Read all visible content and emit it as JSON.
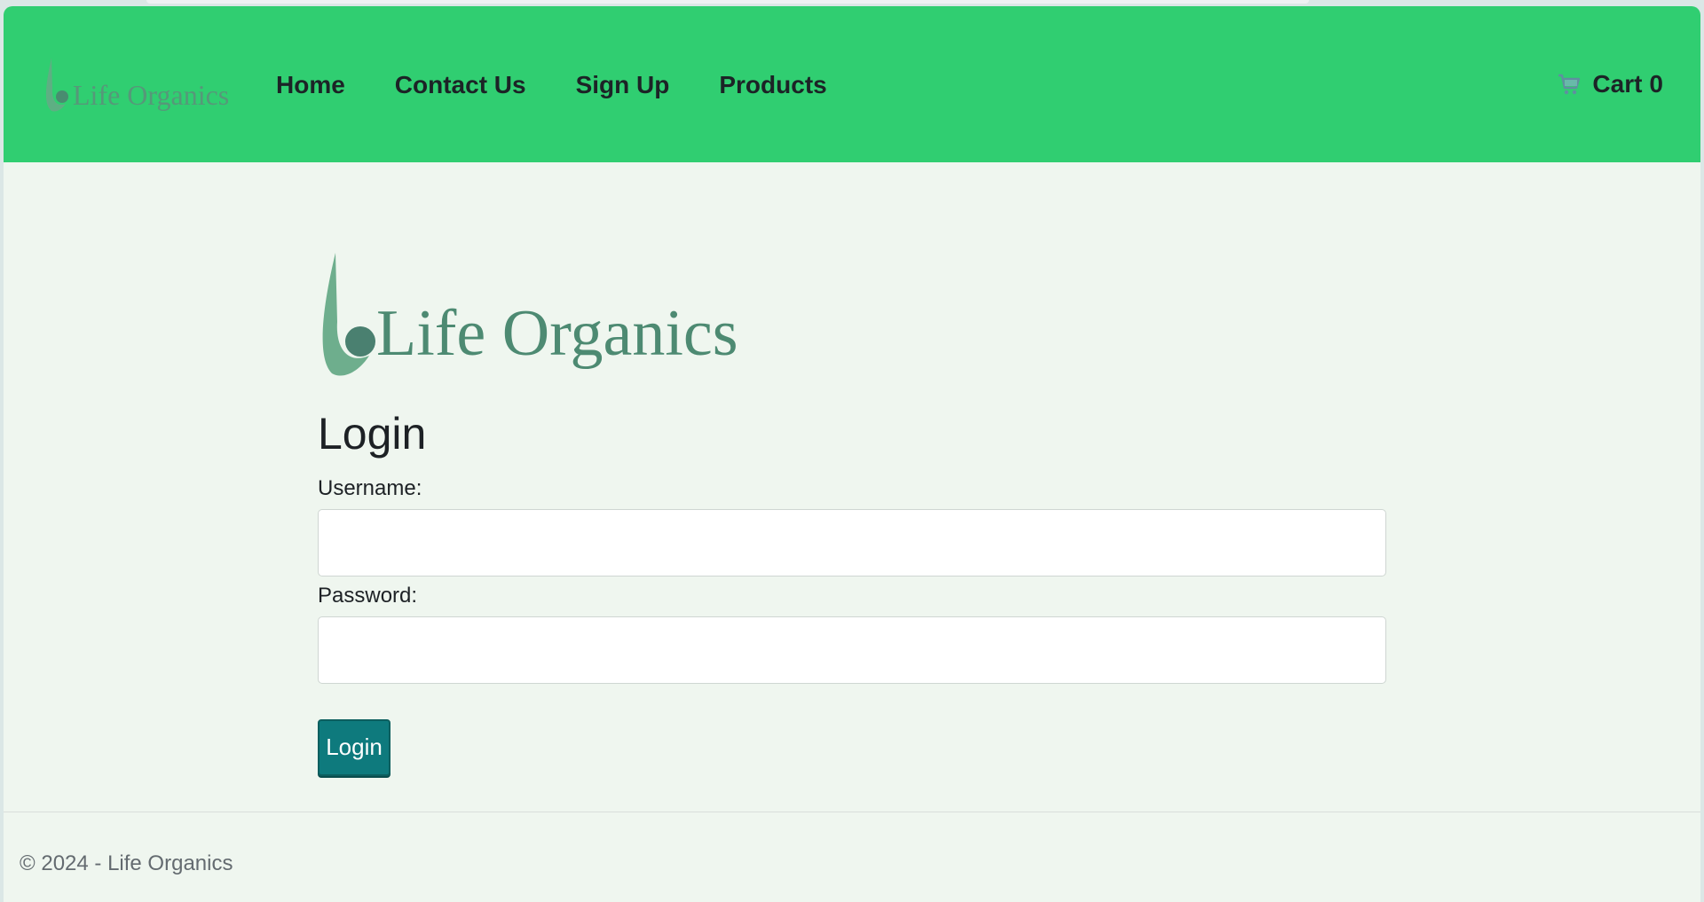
{
  "brand": {
    "name": "Life Organics"
  },
  "nav": {
    "links": [
      "Home",
      "Contact Us",
      "Sign Up",
      "Products"
    ],
    "cart_label": "Cart",
    "cart_count": "0"
  },
  "login": {
    "title": "Login",
    "username_label": "Username:",
    "username_value": "",
    "password_label": "Password:",
    "password_value": "",
    "submit_label": "Login"
  },
  "footer": {
    "text": "© 2024 - Life Organics"
  },
  "colors": {
    "navbar": "#30ce71",
    "page_background": "#eff6ef",
    "button": "#0e7a7d",
    "logo": "#4d8a72"
  },
  "icons": {
    "cart": "cart-icon"
  }
}
